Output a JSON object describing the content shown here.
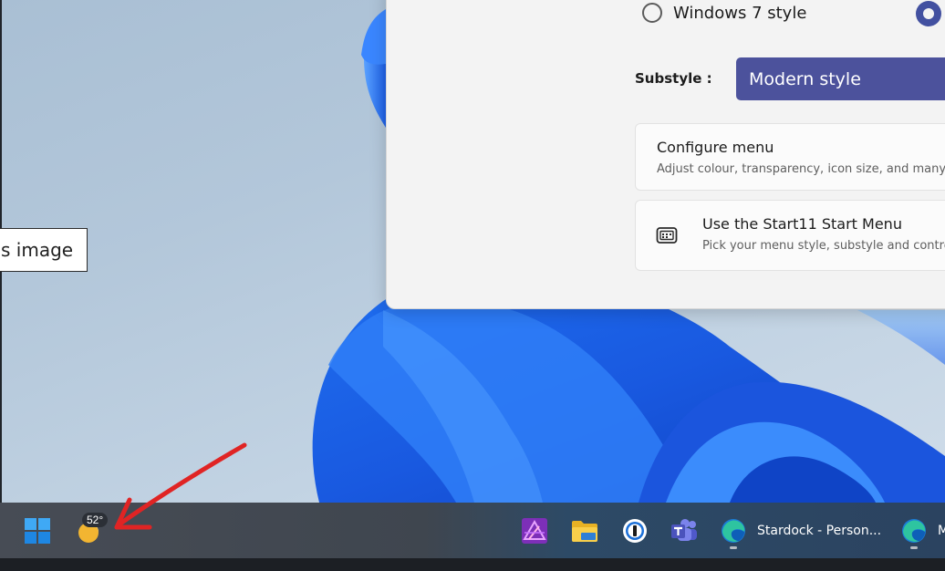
{
  "desktop": {
    "caption_text": "s image"
  },
  "window": {
    "radio_options": [
      {
        "label": "Windows 7 style",
        "selected": false
      },
      {
        "label": "",
        "selected": true
      }
    ],
    "substyle_label": "Substyle :",
    "substyle_value": "Modern style",
    "cards": [
      {
        "title": "Configure menu",
        "subtitle": "Adjust colour, transparency, icon size, and many o"
      },
      {
        "title": "Use the Start11 Start Menu",
        "subtitle": "Pick your menu style, substyle and contro",
        "icon": "start-menu-icon"
      }
    ]
  },
  "taskbar": {
    "weather_temp": "52°",
    "weather_icon": "sun-moon-icon",
    "apps": [
      {
        "name": "affinity-photo-icon",
        "running": false
      },
      {
        "name": "file-explorer-icon",
        "running": false
      },
      {
        "name": "1password-icon",
        "running": false
      },
      {
        "name": "teams-icon",
        "running": false
      },
      {
        "name": "edge-icon",
        "label": "Stardock - Person...",
        "running": true
      },
      {
        "name": "edge-icon",
        "label": "M",
        "running": true
      }
    ]
  },
  "annotation": {
    "arrow_color": "#e02424"
  }
}
